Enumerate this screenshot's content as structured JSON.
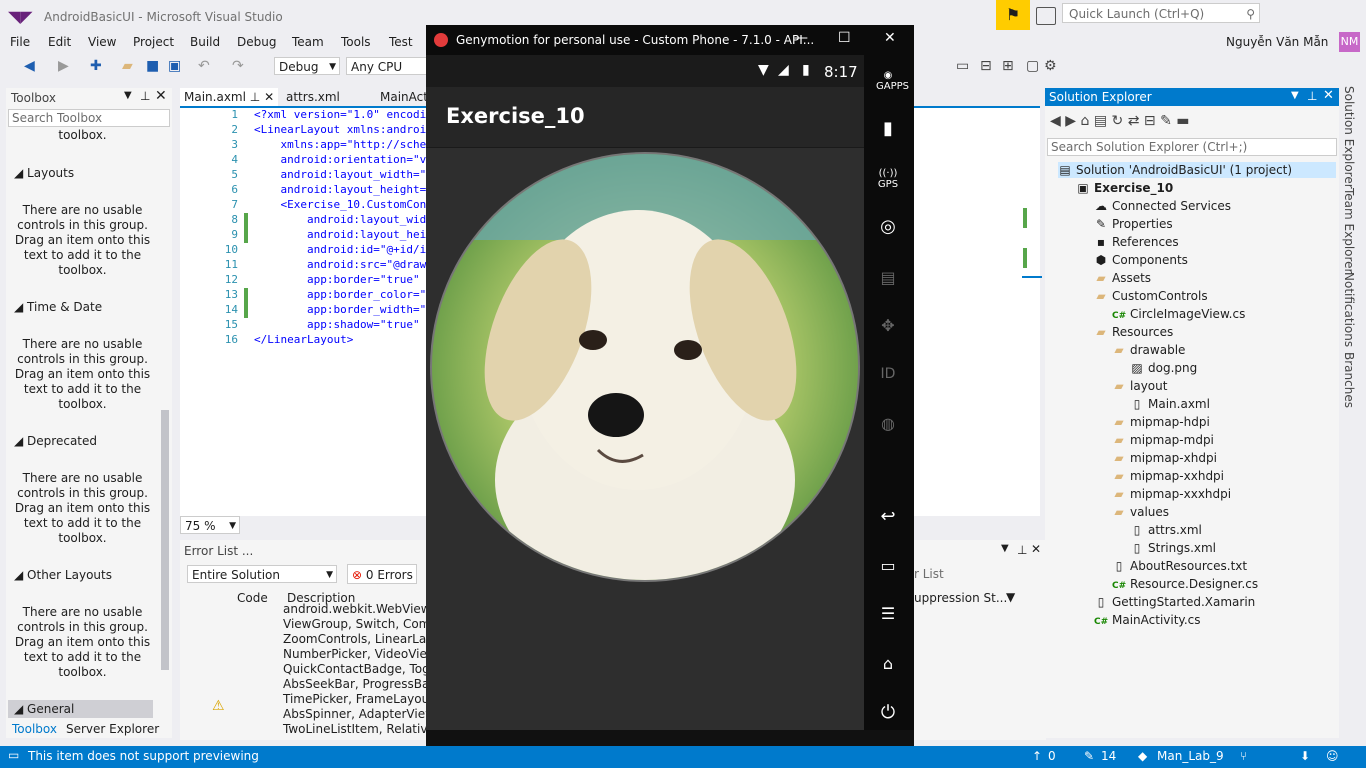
{
  "window": {
    "title": "AndroidBasicUI - Microsoft Visual Studio",
    "quick_launch_placeholder": "Quick Launch (Ctrl+Q)",
    "user_name": "Nguyễn Văn Mẫn",
    "user_initials": "NM"
  },
  "menu": [
    "File",
    "Edit",
    "View",
    "Project",
    "Build",
    "Debug",
    "Team",
    "Tools",
    "Test"
  ],
  "toolbar": {
    "config": "Debug",
    "platform": "Any CPU"
  },
  "toolbox": {
    "title": "Toolbox",
    "search_placeholder": "Search Toolbox",
    "truncated_line": "toolbox.",
    "groups": [
      {
        "name": "Layouts",
        "msg": "There are no usable controls in this group. Drag an item onto this text to add it to the toolbox."
      },
      {
        "name": "Time & Date",
        "msg": "There are no usable controls in this group. Drag an item onto this text to add it to the toolbox."
      },
      {
        "name": "Deprecated",
        "msg": "There are no usable controls in this group. Drag an item onto this text to add it to the toolbox."
      },
      {
        "name": "Other Layouts",
        "msg": "There are no usable controls in this group. Drag an item onto this text to add it to the toolbox."
      }
    ],
    "general": "General",
    "tabs": [
      "Toolbox",
      "Server Explorer"
    ]
  },
  "editor": {
    "tabs": [
      "Main.axml",
      "attrs.xml",
      "MainAct"
    ],
    "lines": [
      {
        "n": "1",
        "code": "<?xml version=\"1.0\" encodi"
      },
      {
        "n": "2",
        "code": "<LinearLayout xmlns:androi"
      },
      {
        "n": "3",
        "code": "    xmlns:app=\"http://sche"
      },
      {
        "n": "4",
        "code": "    android:orientation=\"v"
      },
      {
        "n": "5",
        "code": "    android:layout_width=\""
      },
      {
        "n": "6",
        "code": "    android:layout_height="
      },
      {
        "n": "7",
        "code": "    <Exercise_10.CustomCon"
      },
      {
        "n": "8",
        "code": "        android:layout_wid"
      },
      {
        "n": "9",
        "code": "        android:layout_hei"
      },
      {
        "n": "10",
        "code": "        android:id=\"@+id/i"
      },
      {
        "n": "11",
        "code": "        android:src=\"@draw"
      },
      {
        "n": "12",
        "code": "        app:border=\"true\""
      },
      {
        "n": "13",
        "code": "        app:border_color=\""
      },
      {
        "n": "14",
        "code": "        app:border_width=\""
      },
      {
        "n": "15",
        "code": "        app:shadow=\"true\""
      },
      {
        "n": "16",
        "code": "</LinearLayout>"
      }
    ],
    "zoom": "75 %"
  },
  "error_list": {
    "title": "Error List ...",
    "scope": "Entire Solution",
    "errors": "0 Errors",
    "search_placeholder": "r List",
    "columns": [
      "Code",
      "Description",
      "uppression St..."
    ],
    "rows": [
      "android.webkit.WebView, A",
      "ViewGroup, Switch, Compo",
      "ZoomControls, LinearLayou",
      "NumberPicker, VideoView,",
      "QuickContactBadge, Toggl",
      "AbsSeekBar, ProgressBar, Sp",
      "TimePicker, FrameLayout, D",
      "AbsSpinner, AdapterView, A",
      "TwoLineListItem, RelativeLa"
    ]
  },
  "phone": {
    "window_title": "Genymotion for personal use - Custom Phone - 7.1.0 - API...",
    "clock": "8:17",
    "app_title": "Exercise_10",
    "side_labels": [
      "GAPPS",
      "GPS",
      "ID"
    ]
  },
  "solution_explorer": {
    "title": "Solution Explorer",
    "search_placeholder": "Search Solution Explorer (Ctrl+;)",
    "items": [
      {
        "label": "Solution 'AndroidBasicUI' (1 project)",
        "indent": 0,
        "icon": "solution-icon",
        "sel": true
      },
      {
        "label": "Exercise_10",
        "indent": 1,
        "icon": "project-icon",
        "bold": true
      },
      {
        "label": "Connected Services",
        "indent": 2,
        "icon": "service-icon"
      },
      {
        "label": "Properties",
        "indent": 2,
        "icon": "wrench-icon"
      },
      {
        "label": "References",
        "indent": 2,
        "icon": "references-icon"
      },
      {
        "label": "Components",
        "indent": 2,
        "icon": "component-icon"
      },
      {
        "label": "Assets",
        "indent": 2,
        "icon": "folder-icon"
      },
      {
        "label": "CustomControls",
        "indent": 2,
        "icon": "folder-icon"
      },
      {
        "label": "CircleImageView.cs",
        "indent": 3,
        "icon": "csharp-icon"
      },
      {
        "label": "Resources",
        "indent": 2,
        "icon": "folder-icon"
      },
      {
        "label": "drawable",
        "indent": 3,
        "icon": "folder-icon"
      },
      {
        "label": "dog.png",
        "indent": 4,
        "icon": "image-icon"
      },
      {
        "label": "layout",
        "indent": 3,
        "icon": "folder-icon"
      },
      {
        "label": "Main.axml",
        "indent": 4,
        "icon": "file-icon"
      },
      {
        "label": "mipmap-hdpi",
        "indent": 3,
        "icon": "folder-icon"
      },
      {
        "label": "mipmap-mdpi",
        "indent": 3,
        "icon": "folder-icon"
      },
      {
        "label": "mipmap-xhdpi",
        "indent": 3,
        "icon": "folder-icon"
      },
      {
        "label": "mipmap-xxhdpi",
        "indent": 3,
        "icon": "folder-icon"
      },
      {
        "label": "mipmap-xxxhdpi",
        "indent": 3,
        "icon": "folder-icon"
      },
      {
        "label": "values",
        "indent": 3,
        "icon": "folder-icon"
      },
      {
        "label": "attrs.xml",
        "indent": 4,
        "icon": "file-icon"
      },
      {
        "label": "Strings.xml",
        "indent": 4,
        "icon": "file-icon"
      },
      {
        "label": "AboutResources.txt",
        "indent": 3,
        "icon": "file-icon"
      },
      {
        "label": "Resource.Designer.cs",
        "indent": 3,
        "icon": "csharp-icon"
      },
      {
        "label": "GettingStarted.Xamarin",
        "indent": 2,
        "icon": "file-icon"
      },
      {
        "label": "MainActivity.cs",
        "indent": 2,
        "icon": "csharp-icon"
      }
    ]
  },
  "right_tabs": [
    "Solution Explorer",
    "Team Explorer",
    "Notifications",
    "Branches"
  ],
  "status_bar": {
    "message": "This item does not support previewing",
    "up_count": "0",
    "edit_count": "14",
    "branch": "Man_Lab_9"
  },
  "colors": {
    "accent": "#007acc",
    "status_bar": "#007acc",
    "notify": "#ffcc00"
  }
}
